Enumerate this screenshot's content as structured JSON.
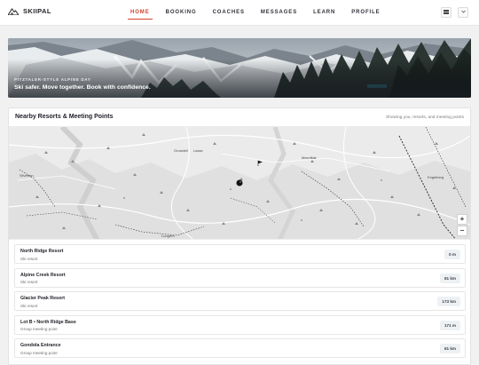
{
  "app": {
    "brand": "SKIIPAL",
    "brand_icon": "mountain-logo-icon",
    "accent_color": "#d6402c"
  },
  "nav": [
    {
      "label": "HOME",
      "active": true
    },
    {
      "label": "BOOKING",
      "active": false
    },
    {
      "label": "COACHES",
      "active": false
    },
    {
      "label": "MESSAGES",
      "active": false
    },
    {
      "label": "LEARN",
      "active": false
    },
    {
      "label": "PROFILE",
      "active": false
    }
  ],
  "header_actions": {
    "language_icon": "flag-icon",
    "menu_icon": "chevron-down-icon"
  },
  "hero": {
    "eyebrow": "PITZTALER-STYLE ALPINE DAY",
    "title": "Ski safer. Move together. Book with confidence."
  },
  "nearby": {
    "title": "Nearby Resorts & Meeting Points",
    "subtitle": "Showing you, resorts, and meeting points",
    "map_labels": [
      "Silverton",
      "Grossteil",
      "Lasse",
      "Mesnillak",
      "Engelberg",
      "Lungern"
    ],
    "zoom_in": "+",
    "zoom_out": "−",
    "locations": [
      {
        "name": "North Ridge Resort",
        "type": "Ski resort",
        "distance": "0 m"
      },
      {
        "name": "Alpine Creek Resort",
        "type": "Ski resort",
        "distance": "61 km"
      },
      {
        "name": "Glacier Peak Resort",
        "type": "Ski resort",
        "distance": "173 km"
      },
      {
        "name": "Lot B • North Ridge Base",
        "type": "Group meeting point",
        "distance": "171 m"
      },
      {
        "name": "Gondola Entrance",
        "type": "Group meeting point",
        "distance": "61 km"
      }
    ]
  }
}
